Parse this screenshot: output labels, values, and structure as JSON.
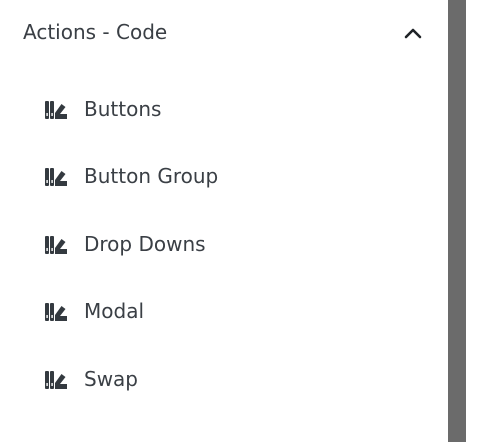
{
  "section": {
    "title": "Actions - Code",
    "expanded": true,
    "toggle_icon": "chevron-up-icon"
  },
  "items": [
    {
      "label": "Buttons",
      "icon": "swatchbook-icon"
    },
    {
      "label": "Button Group",
      "icon": "swatchbook-icon"
    },
    {
      "label": "Drop Downs",
      "icon": "swatchbook-icon"
    },
    {
      "label": "Modal",
      "icon": "swatchbook-icon"
    },
    {
      "label": "Swap",
      "icon": "swatchbook-icon"
    }
  ],
  "colors": {
    "text": "#3a3f45",
    "icon": "#343a40",
    "scrollbar": "#6b6b6b",
    "background": "#ffffff"
  }
}
